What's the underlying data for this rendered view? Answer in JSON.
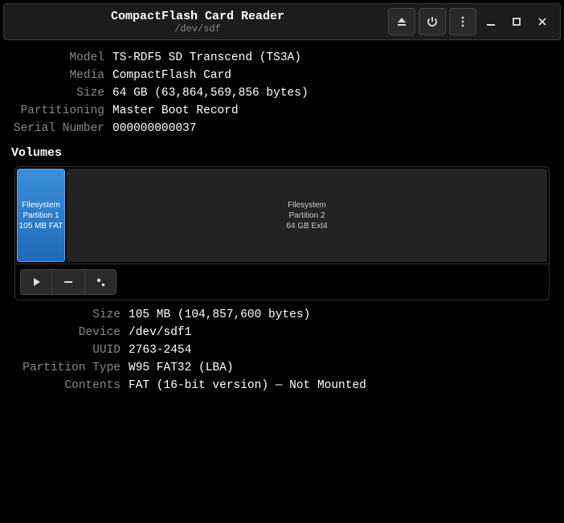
{
  "title": "CompactFlash Card Reader",
  "subtitle": "/dev/sdf",
  "drive": {
    "model_label": "Model",
    "model_value": "TS-RDF5 SD  Transcend (TS3A)",
    "media_label": "Media",
    "media_value": "CompactFlash Card",
    "size_label": "Size",
    "size_value": "64 GB (63,864,569,856 bytes)",
    "partitioning_label": "Partitioning",
    "partitioning_value": "Master Boot Record",
    "serial_label": "Serial Number",
    "serial_value": "000000000037"
  },
  "volumes_heading": "Volumes",
  "partitions": {
    "p1_l1": "Filesystem",
    "p1_l2": "Partition 1",
    "p1_l3": "105 MB FAT",
    "p2_l1": "Filesystem",
    "p2_l2": "Partition 2",
    "p2_l3": "64 GB Ext4"
  },
  "details": {
    "size_label": "Size",
    "size_value": "105 MB (104,857,600 bytes)",
    "device_label": "Device",
    "device_value": "/dev/sdf1",
    "uuid_label": "UUID",
    "uuid_value": "2763-2454",
    "ptype_label": "Partition Type",
    "ptype_value": "W95 FAT32 (LBA)",
    "contents_label": "Contents",
    "contents_value": "FAT (16-bit version) — Not Mounted"
  }
}
